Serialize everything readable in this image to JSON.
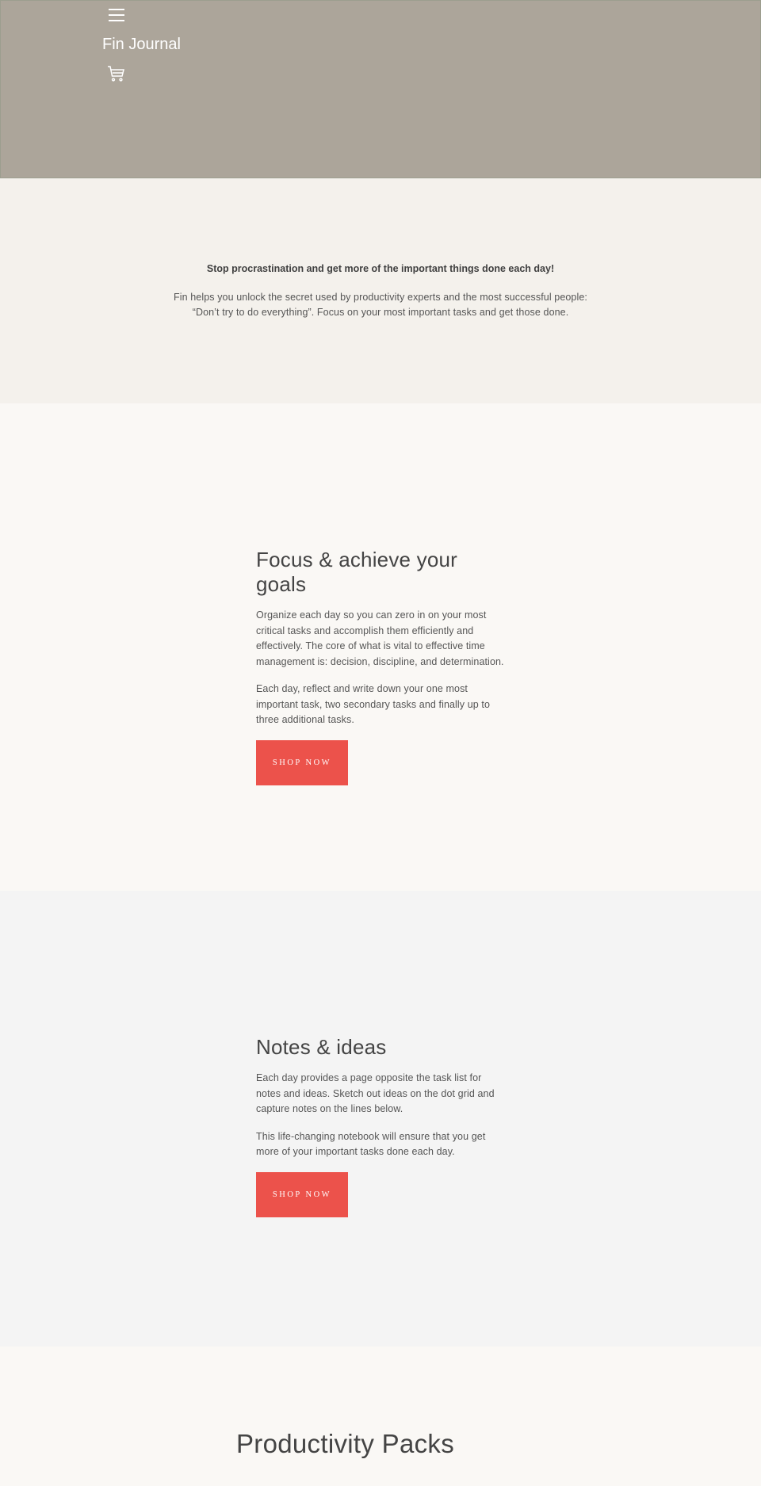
{
  "header": {
    "brand": "Fin Journal",
    "menu_icon": "hamburger-menu-icon",
    "cart_icon": "shopping-cart-icon"
  },
  "intro": {
    "heading": "Stop procrastination and get more of the important things done each day!",
    "text": "Fin helps you unlock the secret used by productivity experts and the most successful people: “Don’t try to do everything”. Focus on your most important tasks and get those done."
  },
  "features": [
    {
      "title": "Focus & achieve your goals",
      "paragraphs": [
        "Organize each day so you can zero in on your most critical tasks and accomplish them efficiently and effectively. The core of what is vital to effective time management is: decision, discipline, and determination.",
        "Each day, reflect and write down your one most important task, two secondary tasks and finally up to three additional tasks."
      ],
      "button": "SHOP NOW"
    },
    {
      "title": "Notes & ideas",
      "paragraphs": [
        "Each day provides a page opposite the task list for notes and ideas. Sketch out ideas on the dot grid and capture notes on the lines below.",
        "This life-changing notebook will ensure that you get more of your important tasks done each day."
      ],
      "button": "SHOP NOW"
    }
  ],
  "packs": {
    "title": "Productivity Packs"
  },
  "colors": {
    "hero_bg": "#aca59a",
    "intro_bg": "#f4f1ec",
    "accent": "#ec524b",
    "text": "#444444"
  }
}
